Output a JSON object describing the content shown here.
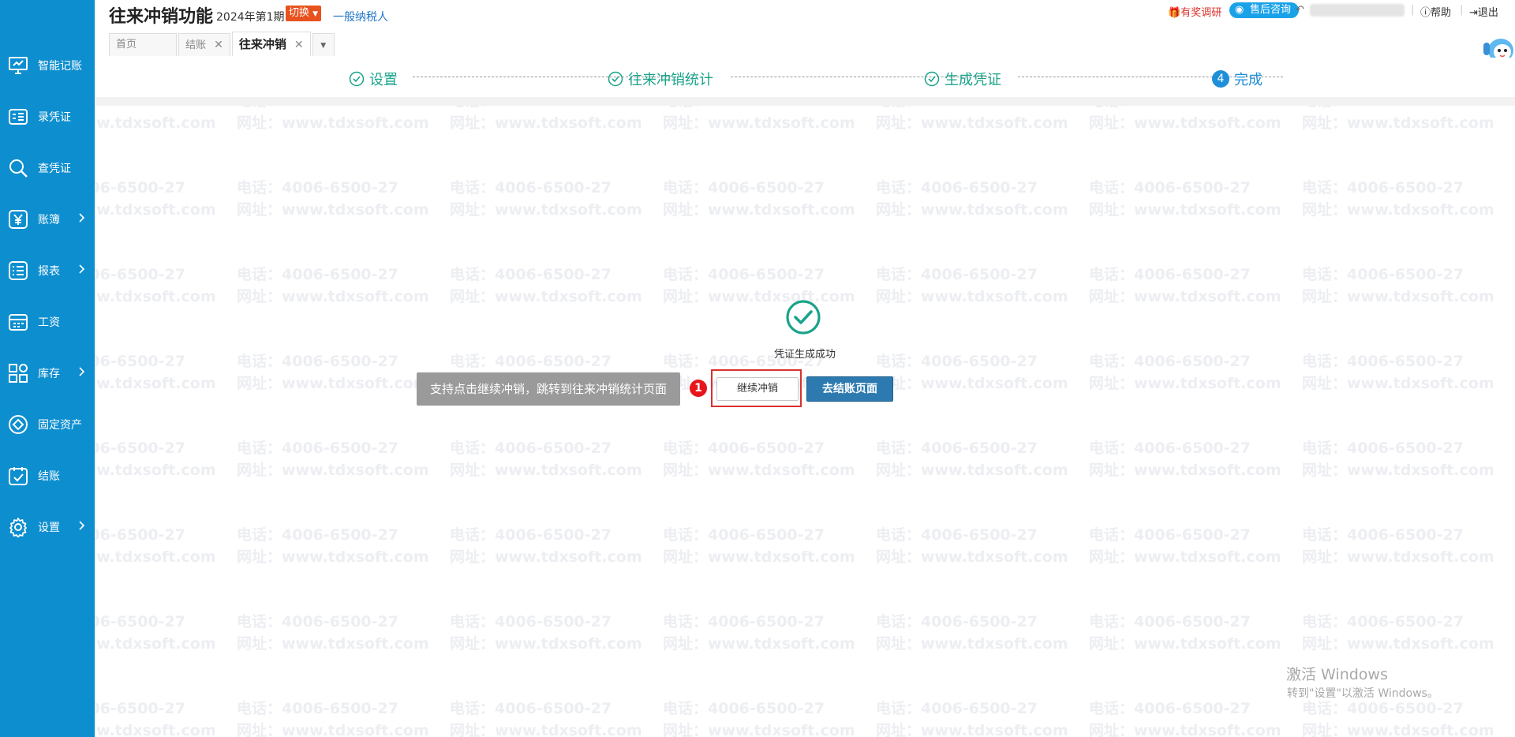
{
  "sidebar": {
    "items": [
      {
        "label": "智能记账",
        "icon": "monitor-icon",
        "arrow": false
      },
      {
        "label": "录凭证",
        "icon": "voucher-edit-icon",
        "arrow": false
      },
      {
        "label": "查凭证",
        "icon": "search-icon",
        "arrow": false
      },
      {
        "label": "账簿",
        "icon": "yen-icon",
        "arrow": true
      },
      {
        "label": "报表",
        "icon": "report-icon",
        "arrow": true
      },
      {
        "label": "工资",
        "icon": "salary-icon",
        "arrow": false
      },
      {
        "label": "库存",
        "icon": "inventory-icon",
        "arrow": true
      },
      {
        "label": "固定资产",
        "icon": "asset-icon",
        "arrow": false
      },
      {
        "label": "结账",
        "icon": "checkout-icon",
        "arrow": false
      },
      {
        "label": "设置",
        "icon": "gear-icon",
        "arrow": true
      }
    ]
  },
  "header": {
    "title": "往来冲销功能",
    "period": "2024年第1期",
    "switch_label": "切换",
    "taxpayer": "一般纳税人",
    "tabs": [
      {
        "label": "首页",
        "closable": false,
        "active": false
      },
      {
        "label": "结账",
        "closable": true,
        "active": false
      },
      {
        "label": "往来冲销",
        "closable": true,
        "active": true
      }
    ],
    "tools": {
      "survey": "有奖调研",
      "service": "售后咨询",
      "help": "帮助",
      "logout": "退出"
    }
  },
  "steps": [
    {
      "label": "设置",
      "status": "done"
    },
    {
      "label": "往来冲销统计",
      "status": "done"
    },
    {
      "label": "生成凭证",
      "status": "done"
    },
    {
      "label": "完成",
      "status": "current",
      "number": "4"
    }
  ],
  "result": {
    "message": "凭证生成成功",
    "tooltip": "支持点击继续冲销，跳转到往来冲销统计页面",
    "badge": "1",
    "continue_label": "继续冲销",
    "close_label": "去结账页面"
  },
  "watermark": {
    "phone": "电话：4006-6500-27",
    "site": "网址：www.tdxsoft.com"
  },
  "windows_activation": {
    "title": "激活 Windows",
    "subtitle": "转到\"设置\"以激活 Windows。"
  },
  "colors": {
    "sidebar": "#0d8ecf",
    "step_done": "#1aa38a",
    "step_current": "#1e8fd8",
    "primary_button": "#2c7ab0",
    "highlight": "#d9302c"
  }
}
